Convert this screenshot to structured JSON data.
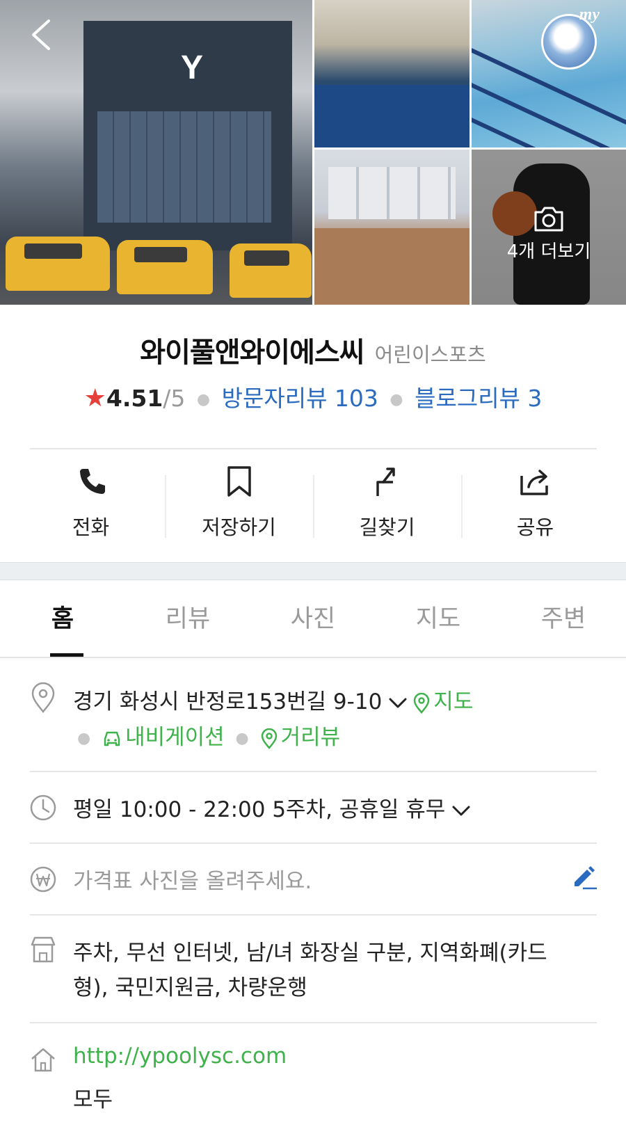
{
  "gallery": {
    "more_photos_label": "4개 더보기",
    "my_badge": "my"
  },
  "place": {
    "name": "와이풀앤와이에스씨",
    "category": "어린이스포츠",
    "rating_star": "★",
    "rating": "4.51",
    "rating_max": "/5",
    "visitor_reviews": "방문자리뷰 103",
    "blog_reviews": "블로그리뷰 3"
  },
  "actions": [
    {
      "label": "전화",
      "icon": "phone-icon"
    },
    {
      "label": "저장하기",
      "icon": "bookmark-icon"
    },
    {
      "label": "길찾기",
      "icon": "directions-icon"
    },
    {
      "label": "공유",
      "icon": "share-icon"
    }
  ],
  "tabs": [
    {
      "label": "홈",
      "active": true
    },
    {
      "label": "리뷰",
      "active": false
    },
    {
      "label": "사진",
      "active": false
    },
    {
      "label": "지도",
      "active": false
    },
    {
      "label": "주변",
      "active": false
    }
  ],
  "info": {
    "address": "경기 화성시 반정로153번길 9-10",
    "map_link": "지도",
    "navigation_link": "내비게이션",
    "streetview_link": "거리뷰",
    "hours": "평일 10:00 - 22:00 5주차, 공휴일 휴무",
    "price_placeholder": "가격표 사진을 올려주세요.",
    "amenities_line1": "주차, 무선 인터넷, 남/녀 화장실 구분, 지역화폐(카드",
    "amenities_line2": "형), 국민지원금, 차량운행",
    "website": "http://ypoolysc.com",
    "website_more": "모두"
  },
  "colors": {
    "accent_green": "#3fb24b",
    "link_blue": "#2a6bc0",
    "star_red": "#e5413a"
  }
}
